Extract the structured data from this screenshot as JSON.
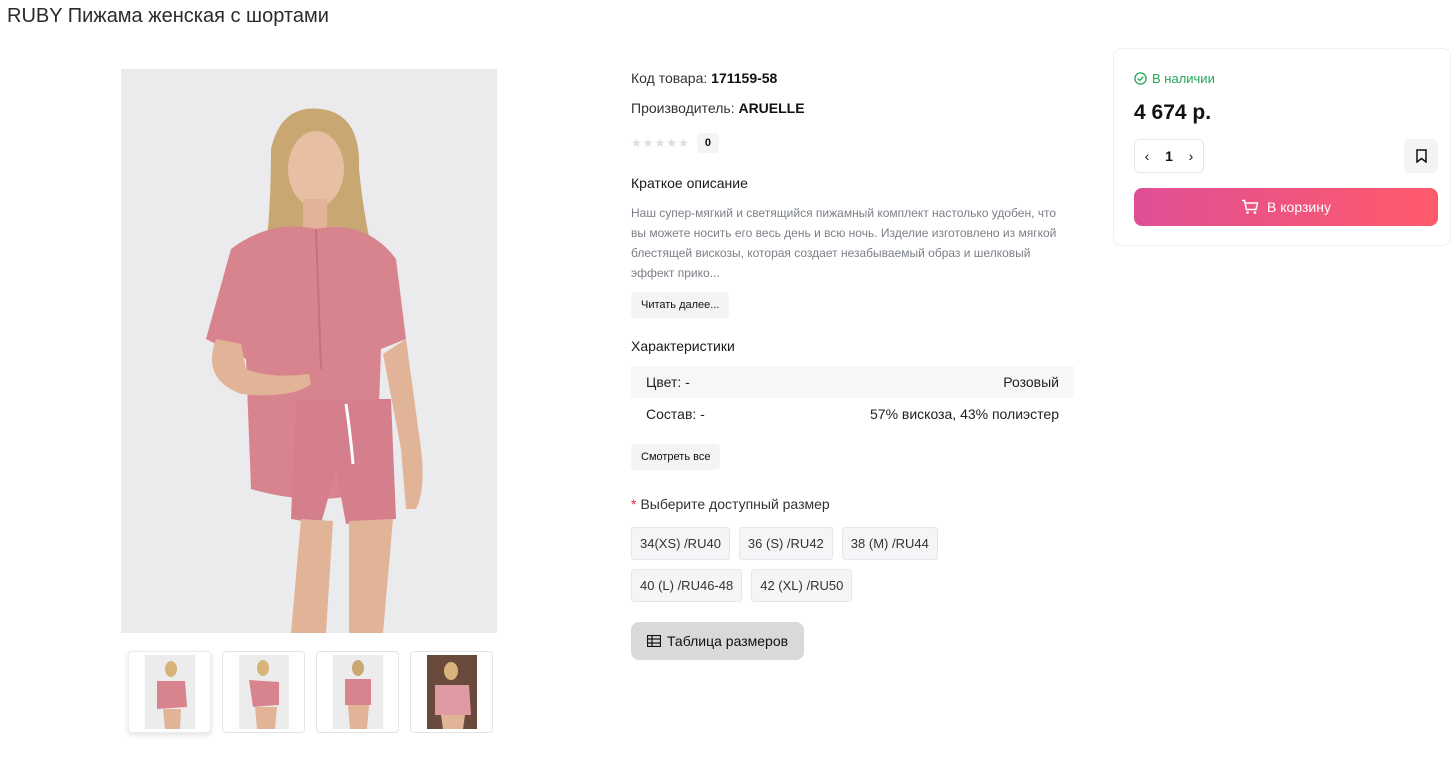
{
  "product": {
    "title": "RUBY Пижама женская с шортами"
  },
  "info": {
    "sku_label": "Код товара:",
    "sku_value": "171159-58",
    "maker_label": "Производитель:",
    "maker_value": "ARUELLE",
    "rating_count": "0",
    "rating_value": 0,
    "short_desc_title": "Краткое описание",
    "short_desc_text": "Наш супер-мягкий и светящийся пижамный комплект настолько удобен, что вы можете носить его весь день и всю ночь. Изделие изготовлено из мягкой блестящей вискозы, которая создает незабываемый образ и шелковый эффект прико...",
    "read_more": "Читать далее...",
    "props_title": "Характеристики",
    "props": [
      {
        "name": "Цвет: -",
        "value": "Розовый"
      },
      {
        "name": "Состав: -",
        "value": "57% вискоза, 43% полиэстер"
      }
    ],
    "see_all": "Смотреть все",
    "size_title": "Выберите доступный размер",
    "sizes": [
      "34(XS) /RU40",
      "36 (S) /RU42",
      "38 (M) /RU44",
      "40 (L) /RU46-48",
      "42 (XL) /RU50"
    ],
    "size_table": "Таблица размеров"
  },
  "buy": {
    "stock": "В наличии",
    "price": "4 674 р.",
    "qty": "1",
    "cart": "В корзину"
  },
  "colors": {
    "accent_start": "#df4f95",
    "accent_end": "#ff5a6b",
    "stock": "#1fa855",
    "required": "#e0263c"
  }
}
